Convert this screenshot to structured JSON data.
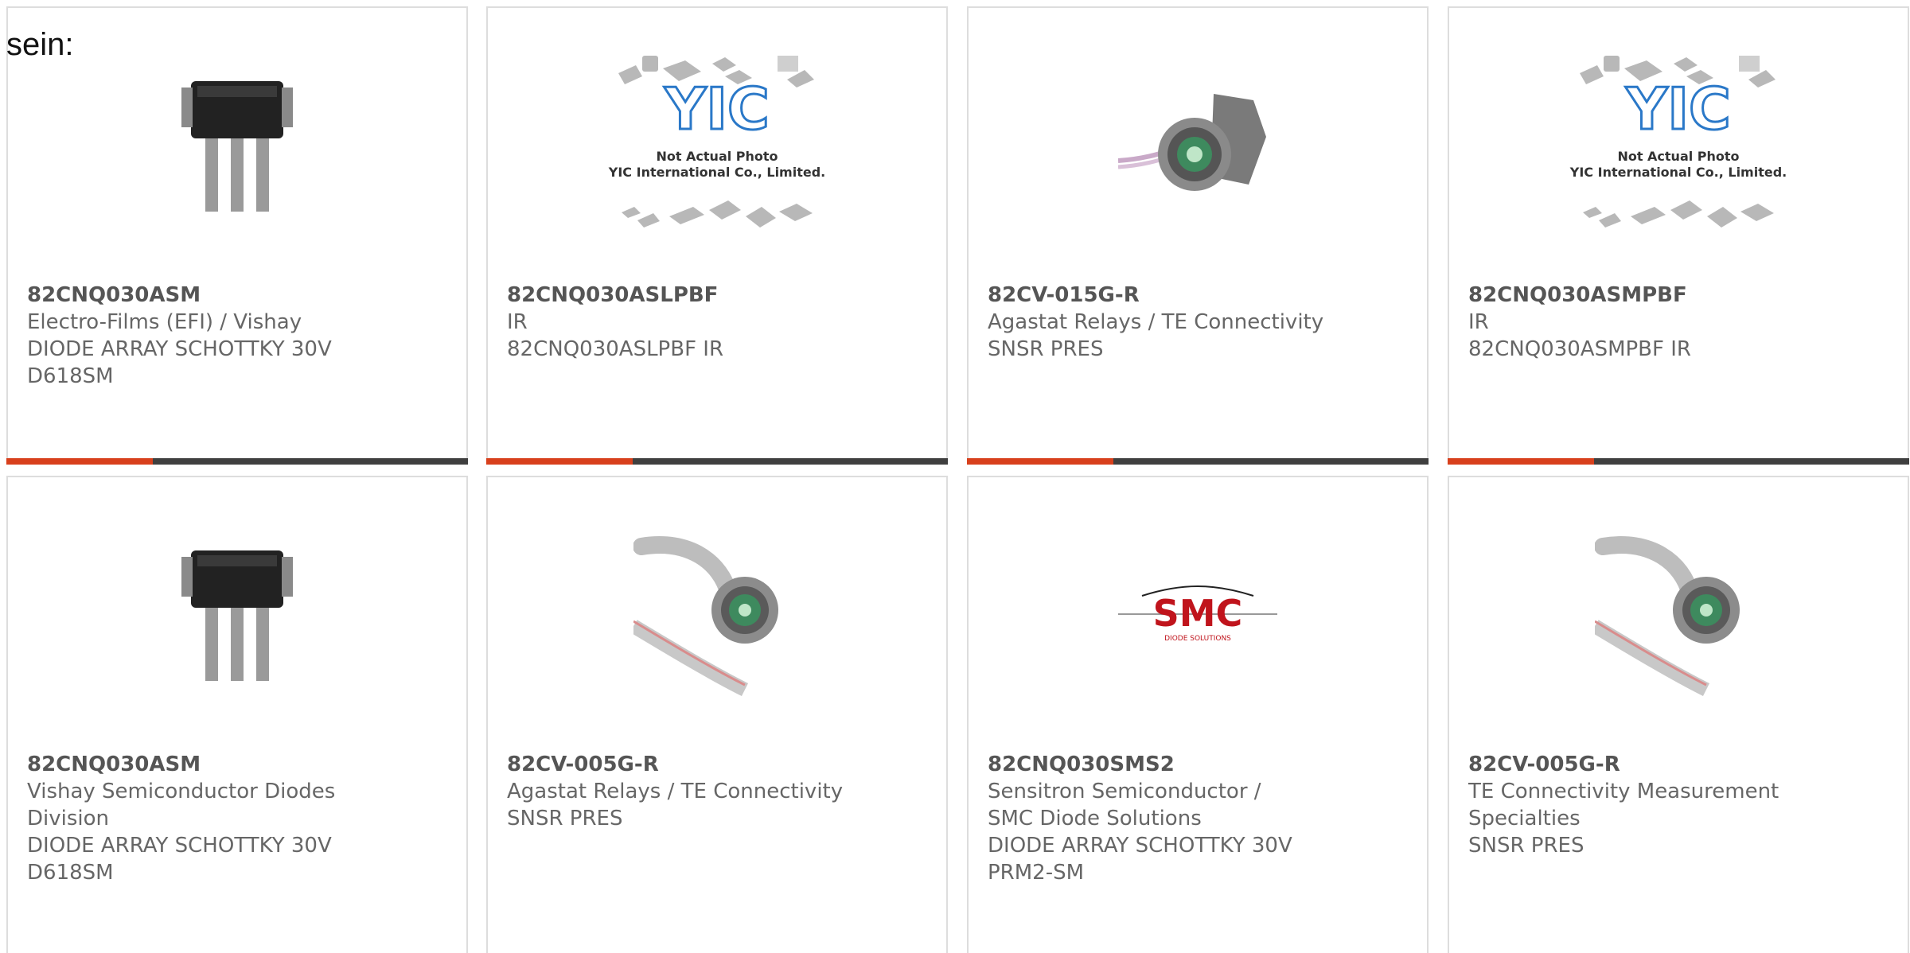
{
  "page": {
    "lead_text": "sein:"
  },
  "colors": {
    "accent": "#d8401c",
    "bar": "#3f3f3f",
    "border": "#dddddd",
    "text": "#666666"
  },
  "cards": [
    {
      "part": "82CNQ030ASM",
      "maker": "Electro-Films (EFI) / Vishay",
      "desc": "DIODE ARRAY SCHOTTKY 30V",
      "pkg": "D618SM",
      "image": "sot-package-photo"
    },
    {
      "part": "82CNQ030ASLPBF",
      "maker": "IR",
      "desc": "82CNQ030ASLPBF IR",
      "pkg": "",
      "image": "yic-placeholder",
      "placeholder": {
        "logo": "YIC",
        "line1": "Not Actual Photo",
        "line2": "YIC International Co., Limited."
      }
    },
    {
      "part": "82CV-015G-R",
      "maker": "Agastat Relays / TE Connectivity",
      "desc": "SNSR PRES",
      "pkg": "",
      "image": "pressure-sensor-fitting-photo"
    },
    {
      "part": "82CNQ030ASMPBF",
      "maker": "IR",
      "desc": "82CNQ030ASMPBF IR",
      "pkg": "",
      "image": "yic-placeholder",
      "placeholder": {
        "logo": "YIC",
        "line1": "Not Actual Photo",
        "line2": "YIC International Co., Limited."
      }
    },
    {
      "part": "82CNQ030ASM",
      "maker": "Vishay Semiconductor Diodes Division",
      "desc": "DIODE ARRAY SCHOTTKY 30V",
      "pkg": "D618SM",
      "image": "sot-package-photo"
    },
    {
      "part": "82CV-005G-R",
      "maker": "Agastat Relays / TE Connectivity",
      "desc": "SNSR PRES",
      "pkg": "",
      "image": "pressure-sensor-cable-photo"
    },
    {
      "part": "82CNQ030SMS2",
      "maker": "Sensitron Semiconductor / SMC Diode Solutions",
      "desc": "DIODE ARRAY SCHOTTKY 30V",
      "pkg": "PRM2-SM",
      "image": "smc-logo",
      "logo": {
        "main": "SMC",
        "sub": "DIODE SOLUTIONS"
      }
    },
    {
      "part": "82CV-005G-R",
      "maker": "TE Connectivity Measurement Specialties",
      "desc": "SNSR PRES",
      "pkg": "",
      "image": "pressure-sensor-cable-photo"
    }
  ]
}
